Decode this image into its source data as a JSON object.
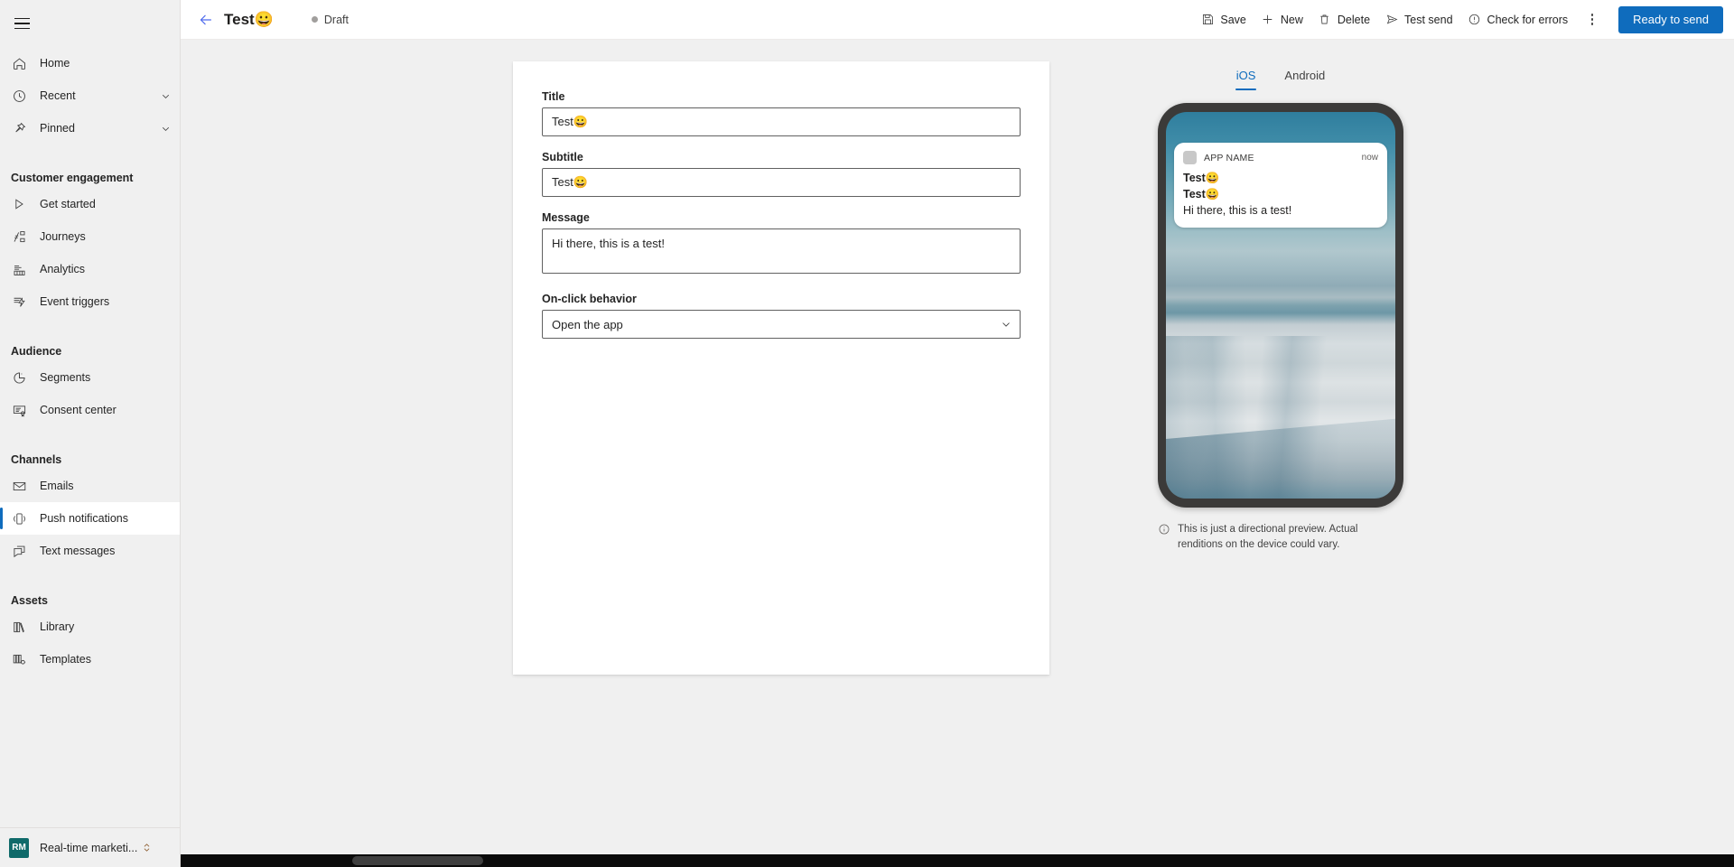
{
  "sidebar": {
    "hamburger_label": "Global navigation",
    "top_items": [
      {
        "label": "Home",
        "icon": "home-icon",
        "expandable": false
      },
      {
        "label": "Recent",
        "icon": "clock-icon",
        "expandable": true
      },
      {
        "label": "Pinned",
        "icon": "pin-icon",
        "expandable": true
      }
    ],
    "groups": [
      {
        "title": "Customer engagement",
        "items": [
          {
            "label": "Get started",
            "icon": "play-icon"
          },
          {
            "label": "Journeys",
            "icon": "journeys-icon"
          },
          {
            "label": "Analytics",
            "icon": "analytics-icon"
          },
          {
            "label": "Event triggers",
            "icon": "event-triggers-icon"
          }
        ]
      },
      {
        "title": "Audience",
        "items": [
          {
            "label": "Segments",
            "icon": "segments-icon"
          },
          {
            "label": "Consent center",
            "icon": "consent-icon"
          }
        ]
      },
      {
        "title": "Channels",
        "items": [
          {
            "label": "Emails",
            "icon": "mail-icon"
          },
          {
            "label": "Push notifications",
            "icon": "phone-icon",
            "selected": true
          },
          {
            "label": "Text messages",
            "icon": "chat-icon"
          }
        ]
      },
      {
        "title": "Assets",
        "items": [
          {
            "label": "Library",
            "icon": "library-icon"
          },
          {
            "label": "Templates",
            "icon": "templates-icon"
          }
        ]
      }
    ],
    "footer": {
      "badge": "RM",
      "label": "Real-time marketi...",
      "badge_color": "#0f6a6a"
    }
  },
  "commandbar": {
    "back_label": "Back",
    "title": "Test😀",
    "status": "Draft",
    "buttons": [
      {
        "label": "Save",
        "icon": "save-icon"
      },
      {
        "label": "New",
        "icon": "plus-icon"
      },
      {
        "label": "Delete",
        "icon": "trash-icon"
      },
      {
        "label": "Test send",
        "icon": "send-icon"
      },
      {
        "label": "Check for errors",
        "icon": "error-circle-icon"
      }
    ],
    "overflow_label": "More commands",
    "primary_button": "Ready to send",
    "accent_color": "#0f6cbd"
  },
  "form": {
    "fields": [
      {
        "label": "Title",
        "value": "Test😀",
        "type": "text",
        "name": "title"
      },
      {
        "label": "Subtitle",
        "value": "Test😀",
        "type": "text",
        "name": "subtitle"
      },
      {
        "label": "Message",
        "value": "Hi there, this is a test!",
        "type": "textarea",
        "name": "message"
      },
      {
        "label": "On-click behavior",
        "value": "Open the app",
        "type": "select",
        "name": "onclick"
      }
    ]
  },
  "preview": {
    "tabs": [
      {
        "label": "iOS",
        "active": true
      },
      {
        "label": "Android",
        "active": false
      }
    ],
    "notification": {
      "app_name": "APP NAME",
      "time": "now",
      "title": "Test😀",
      "subtitle": "Test😀",
      "body": "Hi there, this is a test!"
    },
    "disclaimer": "This is just a directional preview. Actual renditions on the device could vary."
  }
}
